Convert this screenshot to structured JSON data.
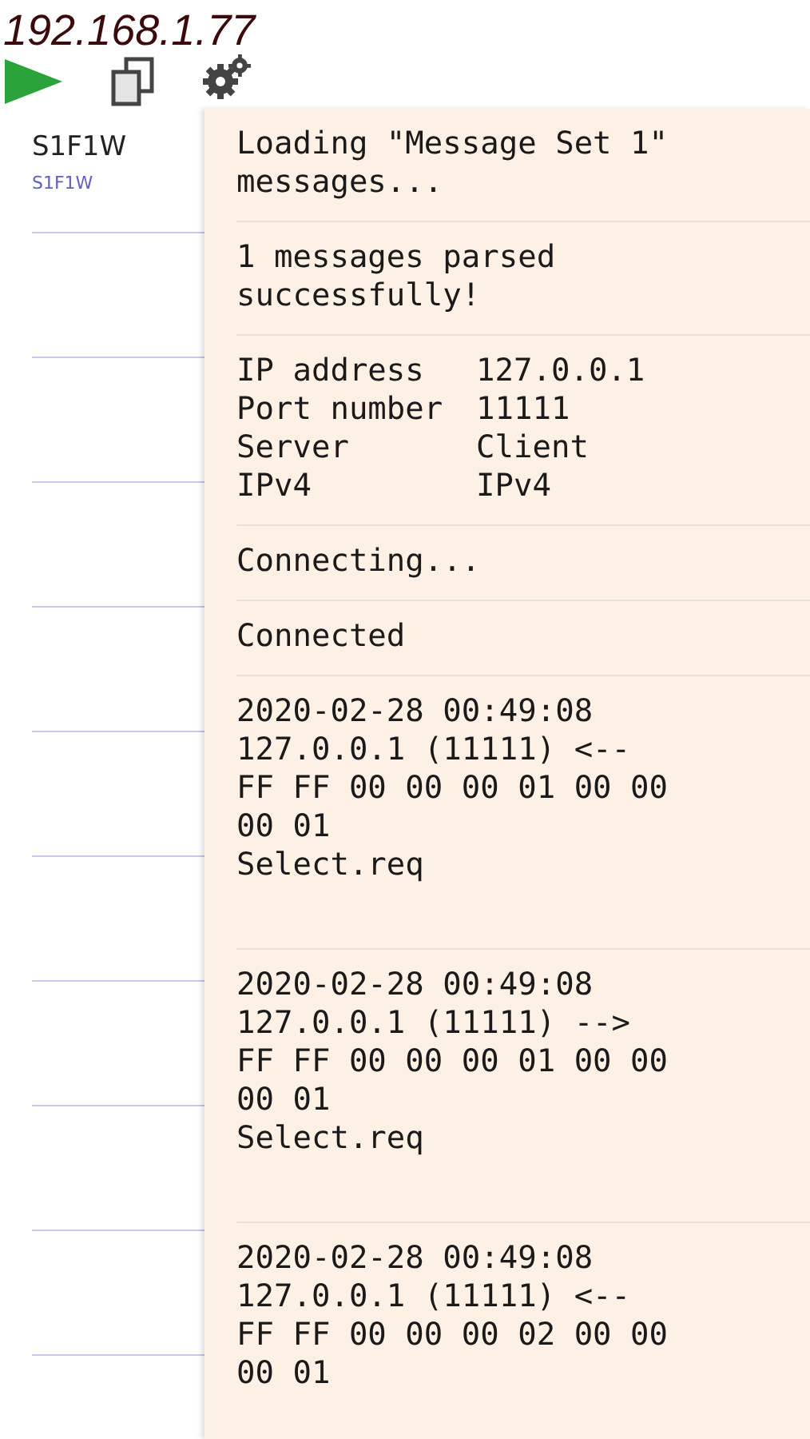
{
  "header": {
    "title": "192.168.1.77"
  },
  "sidebar": {
    "items": [
      {
        "title": "S1F1W",
        "subtitle": "S1F1W",
        "selected": false
      }
    ]
  },
  "log": {
    "entries": [
      {
        "kind": "text",
        "lines": [
          "Loading \"Message Set 1\"",
          "messages..."
        ]
      },
      {
        "kind": "text",
        "lines": [
          "1 messages parsed",
          "successfully!"
        ]
      },
      {
        "kind": "table",
        "rows": [
          {
            "label": "IP address",
            "value": "127.0.0.1"
          },
          {
            "label": "Port number",
            "value": "11111"
          },
          {
            "label": "Server",
            "value": "Client"
          },
          {
            "label": "IPv4",
            "value": "IPv4"
          }
        ]
      },
      {
        "kind": "text",
        "lines": [
          "Connecting..."
        ]
      },
      {
        "kind": "text",
        "lines": [
          "Connected"
        ]
      },
      {
        "kind": "message",
        "lines": [
          "2020-02-28 00:49:08",
          "127.0.0.1 (11111) <--",
          "FF FF 00 00 00 01 00 00",
          "00 01",
          "Select.req"
        ]
      },
      {
        "kind": "message",
        "lines": [
          "2020-02-28 00:49:08",
          "127.0.0.1 (11111) -->",
          "FF FF 00 00 00 01 00 00",
          "00 01",
          "Select.req"
        ]
      },
      {
        "kind": "message",
        "lines": [
          "2020-02-28 00:49:08",
          "127.0.0.1 (11111) <--",
          "FF FF 00 00 00 02 00 00",
          "00 01"
        ]
      }
    ]
  }
}
